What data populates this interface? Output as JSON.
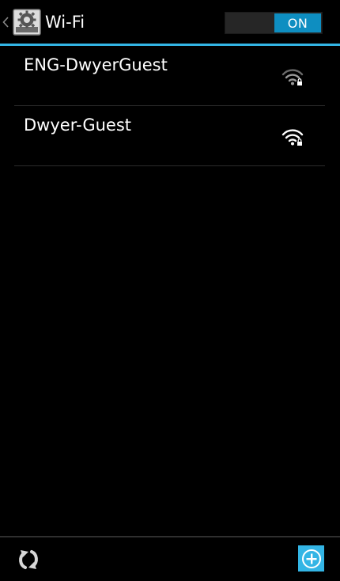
{
  "action_bar": {
    "title": "Wi-Fi",
    "toggle_label": "ON",
    "accent_color": "#33b5e5",
    "icons": {
      "back": "chevron-left-icon",
      "app": "settings-gear-icon"
    }
  },
  "networks": [
    {
      "name": "ENG-DwyerGuest",
      "signal_level": 0.66,
      "secured": true
    },
    {
      "name": "Dwyer-Guest",
      "signal_level": 1.0,
      "secured": true
    }
  ],
  "bottom_bar": {
    "icons": {
      "scan": "refresh-icon",
      "add": "add-network-icon"
    }
  }
}
